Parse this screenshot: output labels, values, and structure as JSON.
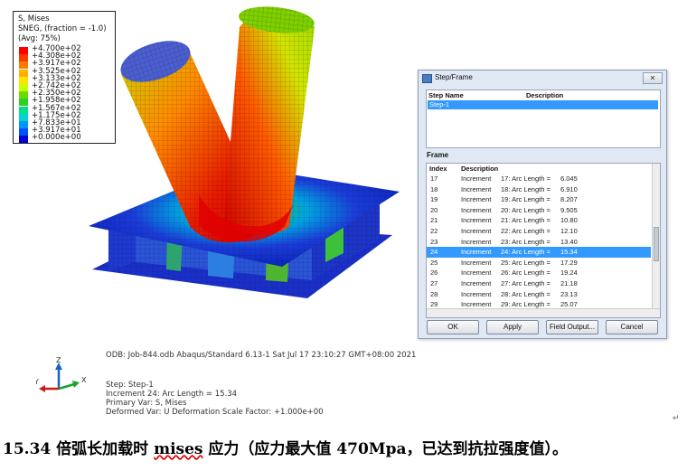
{
  "legend": {
    "title1": "S, Mises",
    "title2": "SNEG, (fraction = -1.0)",
    "title3": "(Avg: 75%)",
    "values": [
      "+4.700e+02",
      "+4.308e+02",
      "+3.917e+02",
      "+3.525e+02",
      "+3.133e+02",
      "+2.742e+02",
      "+2.350e+02",
      "+1.958e+02",
      "+1.567e+02",
      "+1.175e+02",
      "+7.833e+01",
      "+3.917e+01",
      "+0.000e+00"
    ],
    "colors": [
      "#ff0000",
      "#ff3a00",
      "#ff7a00",
      "#ffb100",
      "#ffe100",
      "#c8ff00",
      "#6bdc00",
      "#2bd11e",
      "#00e08c",
      "#00d4d4",
      "#0096ff",
      "#0050ff",
      "#0000d0"
    ]
  },
  "dialog": {
    "title": "Step/Frame",
    "close": "✕",
    "step_name_header": "Step Name",
    "description_header": "Description",
    "step_row": "Step-1",
    "frame_label": "Frame",
    "index_header": "Index",
    "frame_desc_header": "Description",
    "frames": [
      {
        "index": "17",
        "inc": "Increment",
        "desc": "17: Arc Length =",
        "val": "6.045"
      },
      {
        "index": "18",
        "inc": "Increment",
        "desc": "18: Arc Length =",
        "val": "6.910"
      },
      {
        "index": "19",
        "inc": "Increment",
        "desc": "19: Arc Length =",
        "val": "8.207"
      },
      {
        "index": "20",
        "inc": "Increment",
        "desc": "20: Arc Length =",
        "val": "9.505"
      },
      {
        "index": "21",
        "inc": "Increment",
        "desc": "21: Arc Length =",
        "val": "10.80"
      },
      {
        "index": "22",
        "inc": "Increment",
        "desc": "22: Arc Length =",
        "val": "12.10"
      },
      {
        "index": "23",
        "inc": "Increment",
        "desc": "23: Arc Length =",
        "val": "13.40"
      },
      {
        "index": "24",
        "inc": "Increment",
        "desc": "24: Arc Length =",
        "val": "15.34"
      },
      {
        "index": "25",
        "inc": "Increment",
        "desc": "25: Arc Length =",
        "val": "17.29"
      },
      {
        "index": "26",
        "inc": "Increment",
        "desc": "26: Arc Length =",
        "val": "19.24"
      },
      {
        "index": "27",
        "inc": "Increment",
        "desc": "27: Arc Length =",
        "val": "21.18"
      },
      {
        "index": "28",
        "inc": "Increment",
        "desc": "28: Arc Length =",
        "val": "23.13"
      },
      {
        "index": "29",
        "inc": "Increment",
        "desc": "29: Arc Length =",
        "val": "25.07"
      }
    ],
    "selected_index": "24",
    "buttons": {
      "ok": "OK",
      "apply": "Apply",
      "field_output": "Field Output...",
      "cancel": "Cancel"
    }
  },
  "info": {
    "odb_line": "ODB: Job-844.odb    Abaqus/Standard 6.13-1    Sat Jul 17 23:10:27 GMT+08:00 2021",
    "step_line": "Step: Step-1",
    "increment_line": "Increment     24: Arc Length =    15.34",
    "primary_line": "Primary Var: S, Mises",
    "deformed_line": "Deformed Var: U   Deformation Scale Factor: +1.000e+00"
  },
  "triad": {
    "z": "Z",
    "y": "Y",
    "x": "X"
  },
  "caption": {
    "part1": "15.34 倍弧长加载时 ",
    "part2": "mises",
    "part3": " 应力（应力最大值 470Mpa，已达到抗拉强度值）。"
  },
  "para_mark": "↵"
}
